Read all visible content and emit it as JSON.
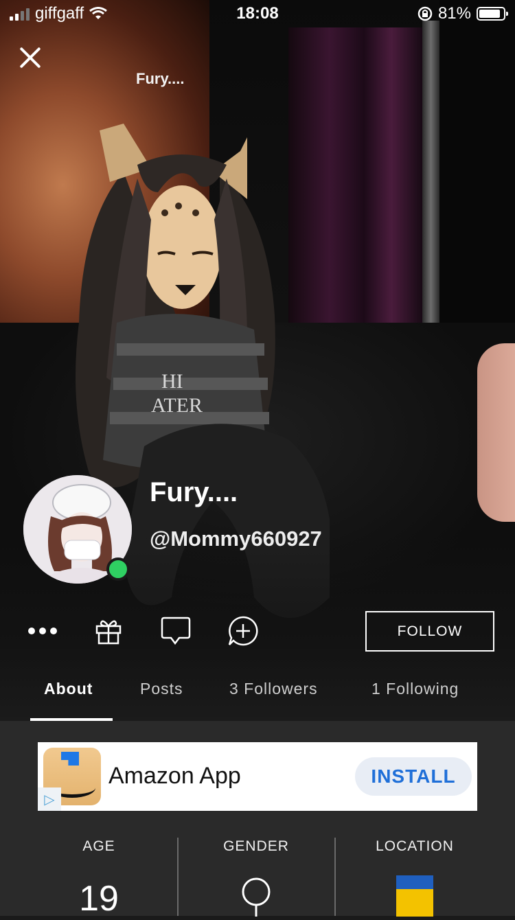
{
  "status_bar": {
    "carrier": "giffgaff",
    "time": "18:08",
    "battery": "81%",
    "battery_level": 0.81
  },
  "header": {
    "title": "Fury...."
  },
  "profile": {
    "display_name": "Fury....",
    "username": "@Mommy660927",
    "online": true
  },
  "actions": {
    "more": "more-options",
    "gift": "gift",
    "message": "message",
    "add_chat": "add-to-chat",
    "follow_label": "FOLLOW"
  },
  "tabs": [
    {
      "label": "About",
      "active": true
    },
    {
      "label": "Posts",
      "active": false
    },
    {
      "label": "3 Followers",
      "active": false
    },
    {
      "label": "1 Following",
      "active": false
    }
  ],
  "ad": {
    "app_name": "Amazon App",
    "install_label": "INSTALL"
  },
  "stats": {
    "age_label": "AGE",
    "age_value": "19",
    "gender_label": "GENDER",
    "location_label": "LOCATION"
  },
  "colors": {
    "online": "#2fd062",
    "install_text": "#1f6fd8",
    "flag_blue": "#1f5fbf",
    "flag_yellow": "#f3c200"
  }
}
